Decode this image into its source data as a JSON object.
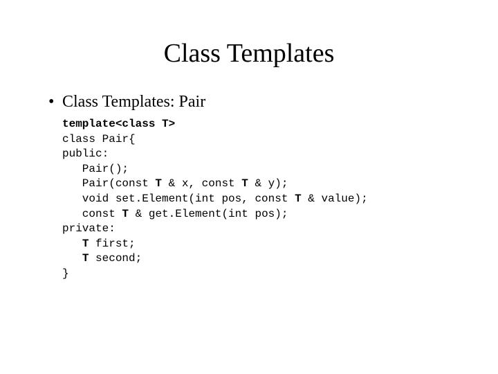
{
  "slide": {
    "title": "Class Templates",
    "bullet": "Class Templates: Pair",
    "code": {
      "l1": "template<class T>",
      "l2": "class Pair{",
      "l3": "public:",
      "l4": "   Pair();",
      "l5a": "   Pair(const ",
      "l5b": "T",
      "l5c": " & x, const ",
      "l5d": "T",
      "l5e": " & y);",
      "l6a": "   void set.Element(int pos, const ",
      "l6b": "T",
      "l6c": " & value);",
      "l7a": "   const ",
      "l7b": "T",
      "l7c": " & get.Element(int pos);",
      "l8": "private:",
      "l9a": "   ",
      "l9b": "T",
      "l9c": " first;",
      "l10a": "   ",
      "l10b": "T",
      "l10c": " second;",
      "l11": "}"
    }
  }
}
